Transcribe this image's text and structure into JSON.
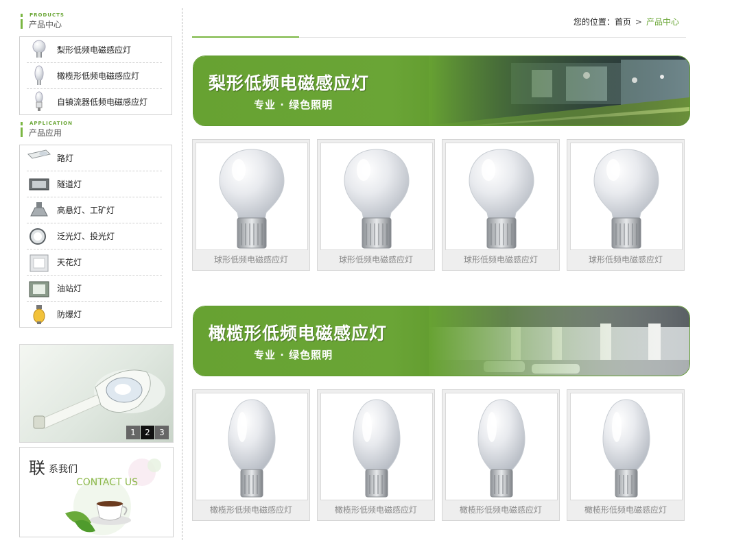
{
  "sidebar": {
    "products": {
      "en": "PRODUCTS",
      "zh": "产品中心",
      "items": [
        {
          "label": "梨形低频电磁感应灯",
          "icon": "pear-bulb-icon"
        },
        {
          "label": "橄榄形低频电磁感应灯",
          "icon": "olive-bulb-icon"
        },
        {
          "label": "自镇流器低频电磁感应灯",
          "icon": "ballast-bulb-icon"
        }
      ]
    },
    "application": {
      "en": "APPLICATION",
      "zh": "产品应用",
      "items": [
        {
          "label": "路灯",
          "icon": "street-lamp-icon"
        },
        {
          "label": "隧道灯",
          "icon": "tunnel-lamp-icon"
        },
        {
          "label": "高悬灯、工矿灯",
          "icon": "high-bay-lamp-icon"
        },
        {
          "label": "泛光灯、投光灯",
          "icon": "floodlight-icon"
        },
        {
          "label": "天花灯",
          "icon": "ceiling-lamp-icon"
        },
        {
          "label": "油站灯",
          "icon": "gas-station-lamp-icon"
        },
        {
          "label": "防爆灯",
          "icon": "explosion-proof-lamp-icon"
        }
      ]
    },
    "promo": {
      "slides": [
        "1",
        "2",
        "3"
      ],
      "active_slide": "2"
    },
    "contact": {
      "big": "联",
      "small": "系我们",
      "en": "CONTACT US"
    }
  },
  "breadcrumb": {
    "prefix": "您的位置：",
    "home": "首页",
    "separator": ">",
    "current": "产品中心"
  },
  "sections": [
    {
      "banner_title": "梨形低频电磁感应灯",
      "banner_subtitle": "专业 · 绿色照明",
      "products": [
        "球形低频电磁感应灯",
        "球形低频电磁感应灯",
        "球形低频电磁感应灯",
        "球形低频电磁感应灯"
      ]
    },
    {
      "banner_title": "橄榄形低频电磁感应灯",
      "banner_subtitle": "专业 · 绿色照明",
      "products": [
        "橄榄形低频电磁感应灯",
        "橄榄形低频电磁感应灯",
        "橄榄形低频电磁感应灯",
        "橄榄形低频电磁感应灯"
      ]
    }
  ],
  "colors": {
    "accent_green": "#7ab642",
    "breadcrumb_current": "#6aa636"
  }
}
